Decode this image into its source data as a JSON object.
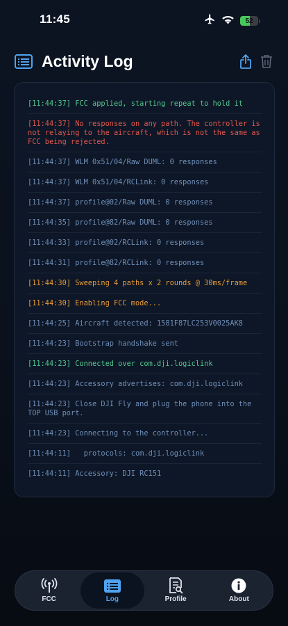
{
  "status_bar": {
    "time": "11:45",
    "battery": "52",
    "battery_level": 0.52,
    "icons": [
      "airplane-icon",
      "wifi-icon",
      "battery-icon"
    ]
  },
  "header": {
    "title": "Activity Log",
    "icon": "list-icon",
    "actions": [
      "share-icon",
      "trash-icon"
    ]
  },
  "colors": {
    "green": "#54c98e",
    "red": "#e0574e",
    "orange": "#e79a37",
    "blue": "#6f8fb8",
    "accent": "#4fa3f0"
  },
  "log": [
    {
      "text": "[11:44:37] FCC applied, starting repeat to hold it",
      "level": "green"
    },
    {
      "text": "[11:44:37] No responses on any path. The controller is not relaying to the aircraft, which is not the same as FCC being rejected.",
      "level": "red"
    },
    {
      "text": "[11:44:37] WLM 0x51/04/Raw DUML: 0 responses",
      "level": "blue"
    },
    {
      "text": "[11:44:37] WLM 0x51/04/RCLink: 0 responses",
      "level": "blue"
    },
    {
      "text": "[11:44:37] profile@02/Raw DUML: 0 responses",
      "level": "blue"
    },
    {
      "text": "[11:44:35] profile@82/Raw DUML: 0 responses",
      "level": "blue"
    },
    {
      "text": "[11:44:33] profile@02/RCLink: 0 responses",
      "level": "blue"
    },
    {
      "text": "[11:44:31] profile@82/RCLink: 0 responses",
      "level": "blue"
    },
    {
      "text": "[11:44:30] Sweeping 4 paths x 2 rounds @ 30ms/frame",
      "level": "orange"
    },
    {
      "text": "[11:44:30] Enabling FCC mode...",
      "level": "orange"
    },
    {
      "text": "[11:44:25] Aircraft detected: 1581F87LC253V0025AK8",
      "level": "blue"
    },
    {
      "text": "[11:44:23] Bootstrap handshake sent",
      "level": "blue"
    },
    {
      "text": "[11:44:23] Connected over com.dji.logiclink",
      "level": "green"
    },
    {
      "text": "[11:44:23] Accessory advertises: com.dji.logiclink",
      "level": "blue"
    },
    {
      "text": "[11:44:23] Close DJI Fly and plug the phone into the TOP USB port.",
      "level": "blue"
    },
    {
      "text": "[11:44:23] Connecting to the controller...",
      "level": "blue"
    },
    {
      "text": "[11:44:11]   protocols: com.dji.logiclink",
      "level": "blue"
    },
    {
      "text": "[11:44:11] Accessory: DJI RC151",
      "level": "blue"
    }
  ],
  "tabs": [
    {
      "label": "FCC",
      "icon": "antenna-icon",
      "active": false
    },
    {
      "label": "Log",
      "icon": "list-icon",
      "active": true
    },
    {
      "label": "Profile",
      "icon": "document-search-icon",
      "active": false
    },
    {
      "label": "About",
      "icon": "info-icon",
      "active": false
    }
  ]
}
